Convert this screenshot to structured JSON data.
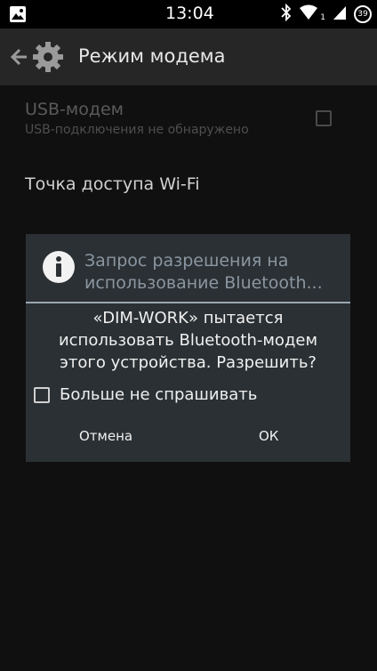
{
  "status_bar": {
    "time": "13:04",
    "sim_indicator": "1",
    "battery_level": "39",
    "icons": [
      "image-notification-icon",
      "bluetooth-icon",
      "wifi-icon",
      "signal-icon",
      "battery-icon"
    ]
  },
  "action_bar": {
    "title": "Режим модема",
    "icons": [
      "back-arrow-icon",
      "gear-icon"
    ]
  },
  "preferences": {
    "usb": {
      "title": "USB-модем",
      "summary": "USB-подключения не обнаружено",
      "checked": false
    },
    "wifi_hotspot": {
      "title": "Точка доступа Wi-Fi"
    }
  },
  "dialog": {
    "icon": "info-icon",
    "title": "Запрос разрешения на использование Bluetooth...",
    "message_lines": [
      "«DIM-WORK» пытается",
      "использовать Bluetooth-модем",
      "этого устройства. Разрешить?"
    ],
    "checkbox_label": "Больше не спрашивать",
    "checkbox_checked": false,
    "cancel_label": "Отмена",
    "ok_label": "ОК"
  },
  "colors": {
    "status_bar_bg": "#000000",
    "action_bar_bg": "#262626",
    "dialog_bg": "#2b3034",
    "dialog_title": "#8a96a0",
    "divider": "#9aa7b0"
  }
}
